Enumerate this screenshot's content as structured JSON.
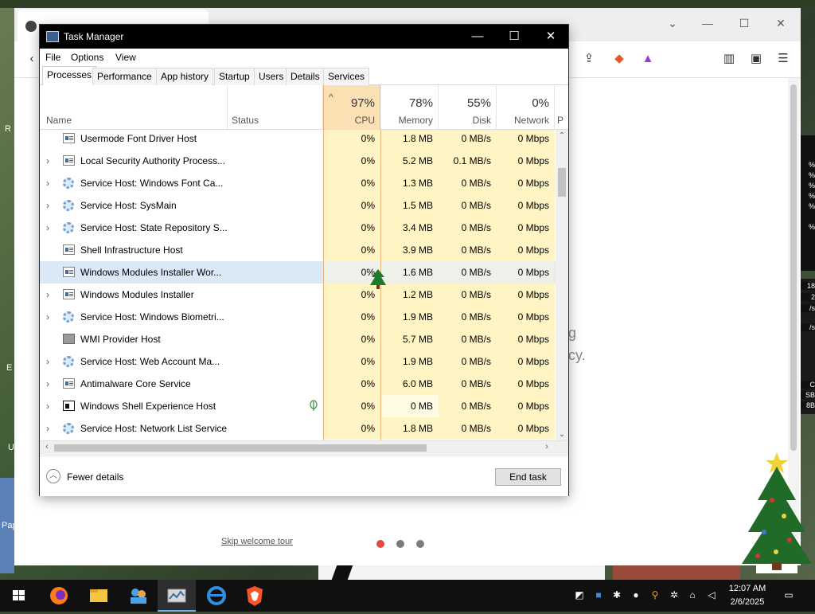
{
  "taskmanager": {
    "title": "Task Manager",
    "window_controls": {
      "minimize": "—",
      "maximize": "☐",
      "close": "✕"
    },
    "menu": [
      "File",
      "Options",
      "View"
    ],
    "tabs": [
      "Processes",
      "Performance",
      "App history",
      "Startup",
      "Users",
      "Details",
      "Services"
    ],
    "active_tab": "Processes",
    "header": {
      "name": "Name",
      "status": "Status",
      "cpu_pct": "97%",
      "cpu": "CPU",
      "memory_pct": "78%",
      "memory": "Memory",
      "disk_pct": "55%",
      "disk": "Disk",
      "network_pct": "0%",
      "network": "Network",
      "power": "P"
    },
    "processes": [
      {
        "expand": "",
        "icon": "app-icon",
        "name": "Usermode Font Driver Host",
        "status": "",
        "cpu": "0%",
        "memory": "1.8 MB",
        "disk": "0 MB/s",
        "network": "0 Mbps"
      },
      {
        "expand": "›",
        "icon": "app-icon",
        "name": "Local Security Authority Process...",
        "status": "",
        "cpu": "0%",
        "memory": "5.2 MB",
        "disk": "0.1 MB/s",
        "network": "0 Mbps"
      },
      {
        "expand": "›",
        "icon": "gear-icon",
        "name": "Service Host: Windows Font Ca...",
        "status": "",
        "cpu": "0%",
        "memory": "1.3 MB",
        "disk": "0 MB/s",
        "network": "0 Mbps"
      },
      {
        "expand": "›",
        "icon": "gear-icon",
        "name": "Service Host: SysMain",
        "status": "",
        "cpu": "0%",
        "memory": "1.5 MB",
        "disk": "0 MB/s",
        "network": "0 Mbps"
      },
      {
        "expand": "›",
        "icon": "gear-icon",
        "name": "Service Host: State Repository S...",
        "status": "",
        "cpu": "0%",
        "memory": "3.4 MB",
        "disk": "0 MB/s",
        "network": "0 Mbps"
      },
      {
        "expand": "",
        "icon": "app-icon",
        "name": "Shell Infrastructure Host",
        "status": "",
        "cpu": "0%",
        "memory": "3.9 MB",
        "disk": "0 MB/s",
        "network": "0 Mbps"
      },
      {
        "expand": "",
        "icon": "app-icon",
        "name": "Windows Modules Installer Wor...",
        "status": "",
        "cpu": "0%",
        "memory": "1.6 MB",
        "disk": "0 MB/s",
        "network": "0 Mbps"
      },
      {
        "expand": "›",
        "icon": "app-icon",
        "name": "Windows Modules Installer",
        "status": "",
        "cpu": "0%",
        "memory": "1.2 MB",
        "disk": "0 MB/s",
        "network": "0 Mbps"
      },
      {
        "expand": "›",
        "icon": "gear-icon",
        "name": "Service Host: Windows Biometri...",
        "status": "",
        "cpu": "0%",
        "memory": "1.9 MB",
        "disk": "0 MB/s",
        "network": "0 Mbps"
      },
      {
        "expand": "",
        "icon": "wmi-icon",
        "name": "WMI Provider Host",
        "status": "",
        "cpu": "0%",
        "memory": "5.7 MB",
        "disk": "0 MB/s",
        "network": "0 Mbps"
      },
      {
        "expand": "›",
        "icon": "gear-icon",
        "name": "Service Host: Web Account Ma...",
        "status": "",
        "cpu": "0%",
        "memory": "1.9 MB",
        "disk": "0 MB/s",
        "network": "0 Mbps"
      },
      {
        "expand": "›",
        "icon": "app-icon",
        "name": "Antimalware Core Service",
        "status": "",
        "cpu": "0%",
        "memory": "6.0 MB",
        "disk": "0 MB/s",
        "network": "0 Mbps"
      },
      {
        "expand": "›",
        "icon": "shell-icon",
        "name": "Windows Shell Experience Host",
        "status": "leaf-icon",
        "cpu": "0%",
        "memory": "0 MB",
        "disk": "0 MB/s",
        "network": "0 Mbps"
      },
      {
        "expand": "›",
        "icon": "gear-icon",
        "name": "Service Host: Network List Service",
        "status": "",
        "cpu": "0%",
        "memory": "1.8 MB",
        "disk": "0 MB/s",
        "network": "0 Mbps"
      }
    ],
    "selected_row": 6,
    "footer": {
      "fewer_details": "Fewer details",
      "end_task": "End task"
    }
  },
  "browser": {
    "skip_tour": "Skip welcome tour",
    "partial_text_1": "g",
    "partial_text_2": "cy."
  },
  "desktop": {
    "left_labels": [
      "R",
      "E",
      "U",
      "Pap"
    ],
    "right_stats": [
      "%",
      "%",
      "%",
      "%",
      "%",
      "%",
      "18",
      "2",
      "/s",
      "/s",
      "C",
      "SB",
      "8B"
    ]
  },
  "taskbar": {
    "apps": [
      "windows-start-icon",
      "firefox-icon",
      "file-explorer-icon",
      "people-icon",
      "task-manager-icon",
      "internet-explorer-icon",
      "brave-icon"
    ],
    "time": "12:07 AM",
    "date": "2/6/2025"
  },
  "colors": {
    "cpu_column": "#fbe0b3",
    "column_heat": "#fff4c4",
    "selected_row": "#dbe8f6",
    "accent": "#6bb3f0"
  }
}
